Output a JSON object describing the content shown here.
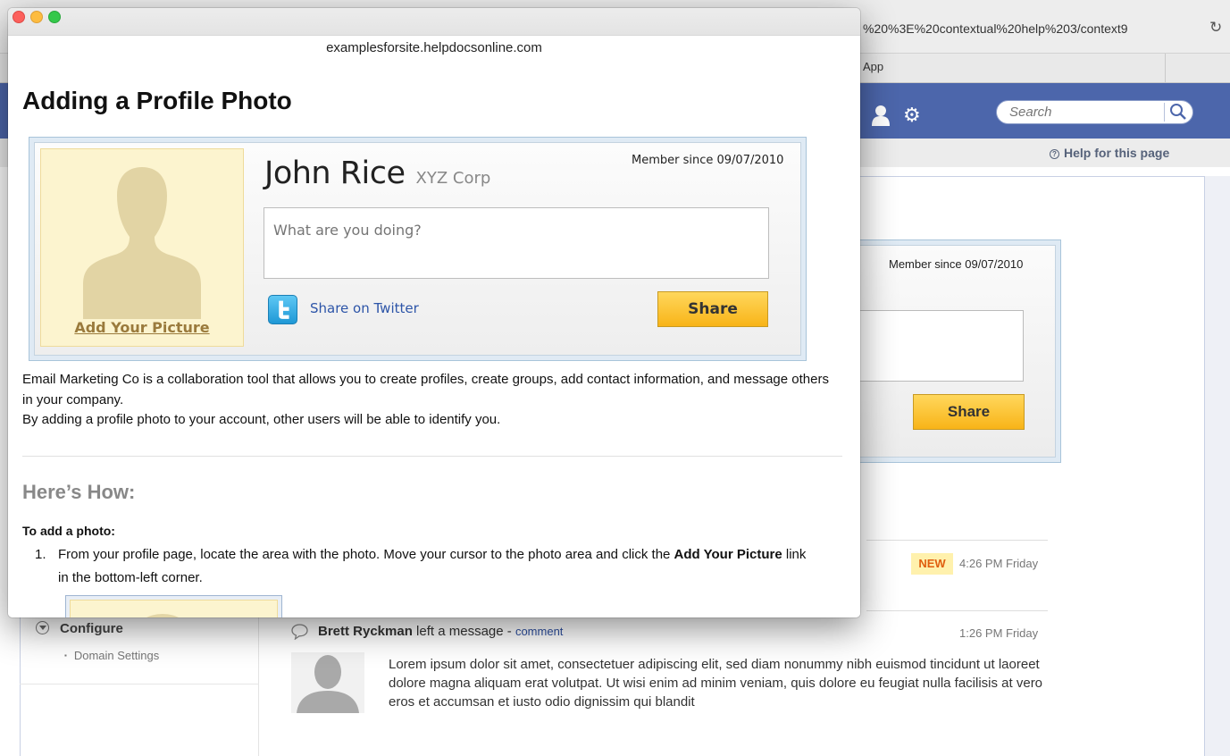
{
  "background_browser": {
    "url_fragment": "%20%3E%20contextual%20help%203/context9",
    "tab_label": "App",
    "search_placeholder": "Search",
    "help_link": "Help for this page",
    "card": {
      "member_since": "Member since 09/07/2010",
      "share_label": "Share"
    },
    "feed": {
      "new_badge": "NEW",
      "time_1": "4:26 PM Friday",
      "message_author": "Brett Ryckman",
      "message_action": "left a message",
      "message_separator": "-",
      "comment_link": "comment",
      "time_2": "1:26 PM Friday",
      "message_text": "Lorem ipsum dolor sit amet, consectetuer adipiscing elit, sed diam nonummy nibh euismod tincidunt ut laoreet dolore magna aliquam erat volutpat. Ut wisi enim ad minim veniam, quis dolore eu feugiat nulla facilisis at vero eros et accumsan et iusto odio dignissim qui blandit"
    },
    "sidebar": {
      "section_title": "Configure",
      "items": [
        "Domain Settings"
      ]
    },
    "colors": {
      "header": "#4c66ab",
      "share_button": "#f8b418"
    }
  },
  "popup": {
    "domain": "examplesforsite.helpdocsonline.com",
    "title": "Adding a Profile Photo",
    "profile_card": {
      "add_picture": "Add Your Picture",
      "member_since": "Member since 09/07/2010",
      "name": "John Rice",
      "company": "XYZ Corp",
      "status_placeholder": "What are you doing?",
      "twitter_link": "Share on Twitter",
      "share_label": "Share"
    },
    "intro": [
      "Email Marketing Co is a collaboration tool that allows you to create profiles, create groups, add contact information, and message others in your company.",
      "By adding a profile photo to your account, other users will be able to identify you."
    ],
    "howto_title": "Here’s How:",
    "add_photo_heading": "To add a photo:",
    "steps": [
      {
        "number": "1.",
        "text_before": "From your profile page, locate the area with the photo. Move your cursor to the photo area and click the ",
        "bold": "Add Your Picture",
        "text_after": " link in the bottom-left corner."
      }
    ]
  }
}
